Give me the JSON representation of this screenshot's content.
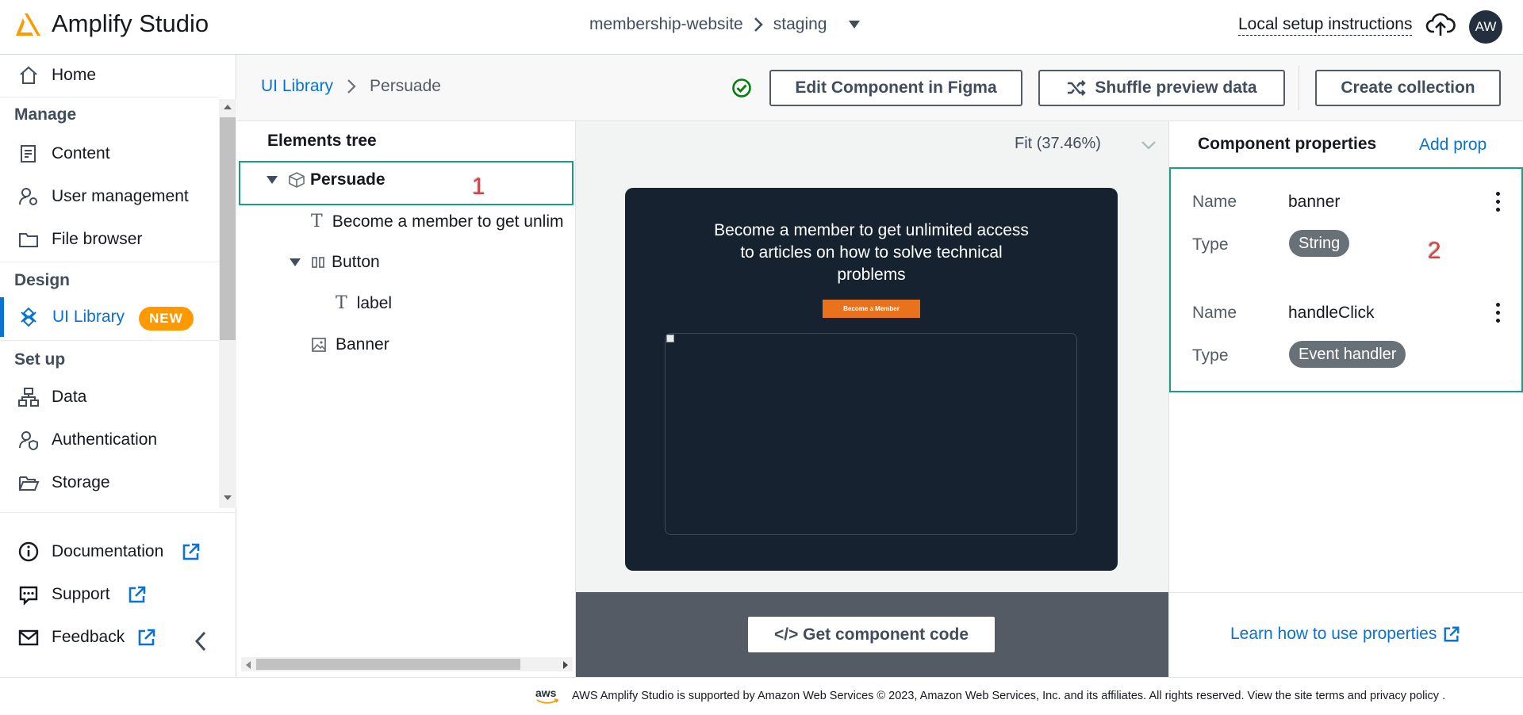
{
  "header": {
    "app_title": "Amplify Studio",
    "app_name": "membership-website",
    "env": "staging",
    "local_setup": "Local setup instructions",
    "avatar_initials": "AW",
    "brand_color": "#ff9900"
  },
  "sidebar": {
    "home": "Home",
    "manage_heading": "Manage",
    "content": "Content",
    "user_management": "User management",
    "file_browser": "File browser",
    "design_heading": "Design",
    "ui_library": "UI Library",
    "new_badge": "NEW",
    "setup_heading": "Set up",
    "data": "Data",
    "authentication": "Authentication",
    "storage": "Storage",
    "documentation": "Documentation",
    "support": "Support",
    "feedback": "Feedback"
  },
  "breadcrumb": {
    "parent": "UI Library",
    "current": "Persuade"
  },
  "toolbar": {
    "edit_figma": "Edit Component in Figma",
    "shuffle": "Shuffle preview data",
    "create_collection": "Create collection"
  },
  "tree": {
    "title": "Elements tree",
    "root": "Persuade",
    "text_node": "Become a member to get unlim",
    "button_node": "Button",
    "label_node": "label",
    "banner_node": "Banner"
  },
  "canvas": {
    "zoom": "Fit (37.46%)",
    "preview_text": "Become a member to get unlimited access to articles on how to solve technical problems",
    "preview_button": "Become a Member",
    "get_code": "</> Get component code"
  },
  "properties": {
    "title": "Component properties",
    "add_prop": "Add prop",
    "name_label": "Name",
    "type_label": "Type",
    "items": [
      {
        "name": "banner",
        "type": "String"
      },
      {
        "name": "handleClick",
        "type": "Event handler"
      }
    ],
    "learn": "Learn how to use properties"
  },
  "annotations": {
    "one": "1",
    "two": "2"
  },
  "footer": {
    "aws": "aws",
    "text": "AWS Amplify Studio is supported by Amazon Web Services © 2023, Amazon Web Services, Inc. and its affiliates. All rights reserved. View the site terms and privacy policy ."
  }
}
